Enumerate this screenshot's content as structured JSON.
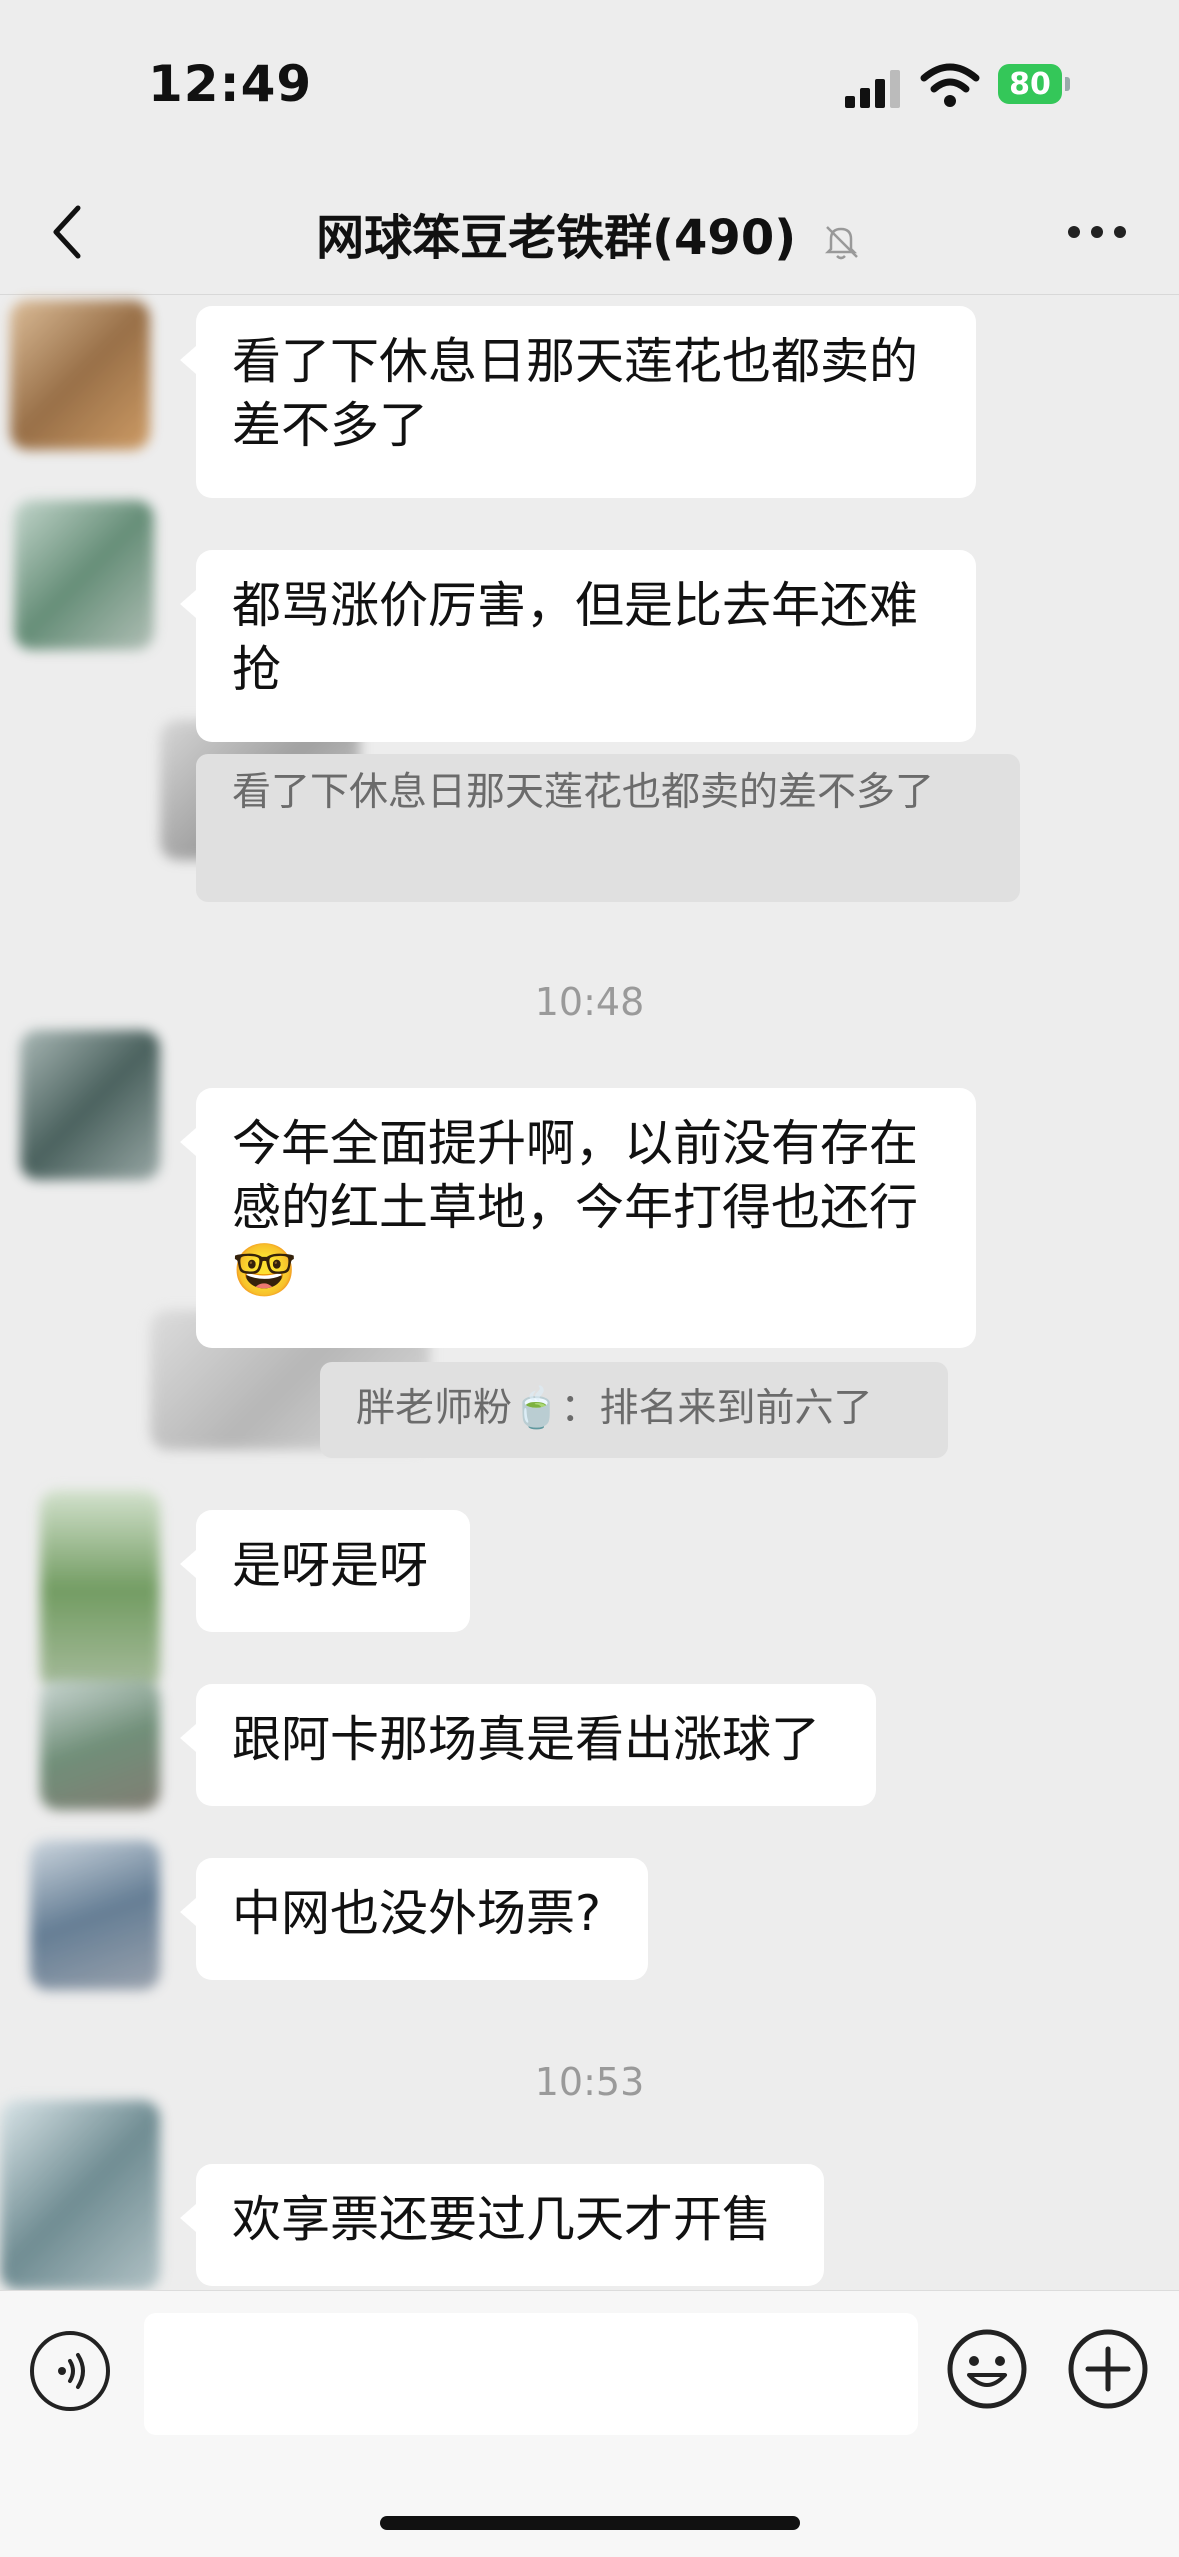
{
  "status_bar": {
    "time": "12:49",
    "battery": "80"
  },
  "header": {
    "title": "网球笨豆老铁群(490)"
  },
  "messages": [
    {
      "text": "看了下休息日那天莲花也都卖的差不多了"
    },
    {
      "text": "都骂涨价厉害，但是比去年还难抢"
    },
    {
      "quote": "看了下休息日那天莲花也都卖的差不多了"
    },
    {
      "timestamp": "10:48"
    },
    {
      "text": "今年全面提升啊，以前没有存在感的红土草地，今年打得也还行",
      "emoji": "🤓"
    },
    {
      "quote": "胖老师粉🍵：排名来到前六了"
    },
    {
      "text": "是呀是呀"
    },
    {
      "text": "跟阿卡那场真是看出涨球了"
    },
    {
      "text": "中网也没外场票?"
    },
    {
      "timestamp": "10:53"
    },
    {
      "text": "欢享票还要过几天才开售"
    }
  ],
  "input": {
    "placeholder": ""
  },
  "icons": {
    "back": "chevron-left-icon",
    "mute": "bell-slash-icon",
    "more": "ellipsis-icon",
    "voice": "voice-icon",
    "emoji": "smiley-icon",
    "plus": "plus-circle-icon"
  },
  "colors": {
    "background": "#ededed",
    "bubble": "#ffffff",
    "quote": "#e0e0e0",
    "battery": "#34c759"
  }
}
